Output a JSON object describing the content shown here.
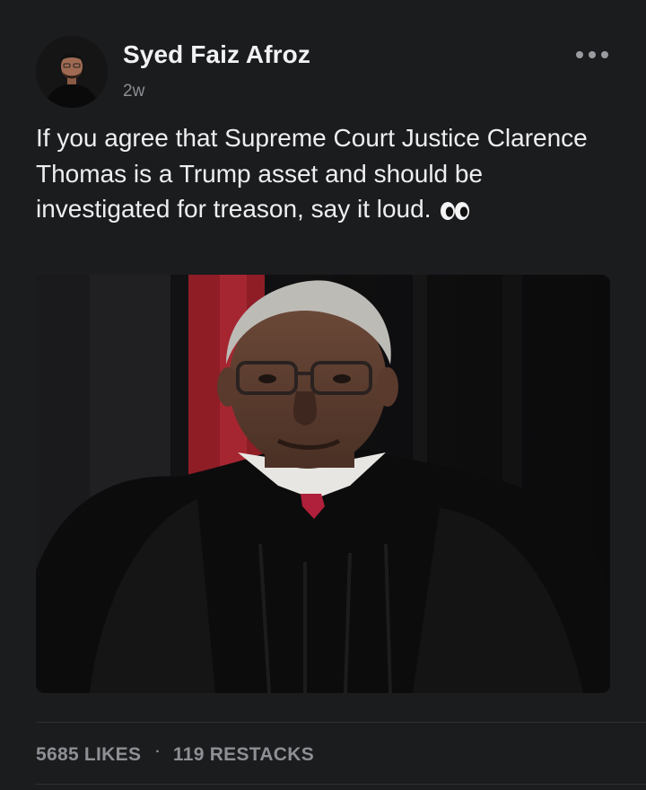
{
  "post": {
    "author": {
      "name": "Syed Faiz Afroz",
      "timestamp": "2w"
    },
    "more_icon": "ellipsis-horizontal-icon",
    "text": "If you agree that Supreme Court Justice Clarence Thomas is a Trump asset and should be investigated for treason, say it loud.",
    "emoji": "👀",
    "stats": {
      "likes_count": "5685",
      "likes_label": "LIKES",
      "separator": "·",
      "restacks_count": "119",
      "restacks_label": "RESTACKS"
    }
  },
  "colors": {
    "background": "#1b1c1e",
    "primary_text": "#eeeeef",
    "secondary_text": "#8e8f94"
  }
}
